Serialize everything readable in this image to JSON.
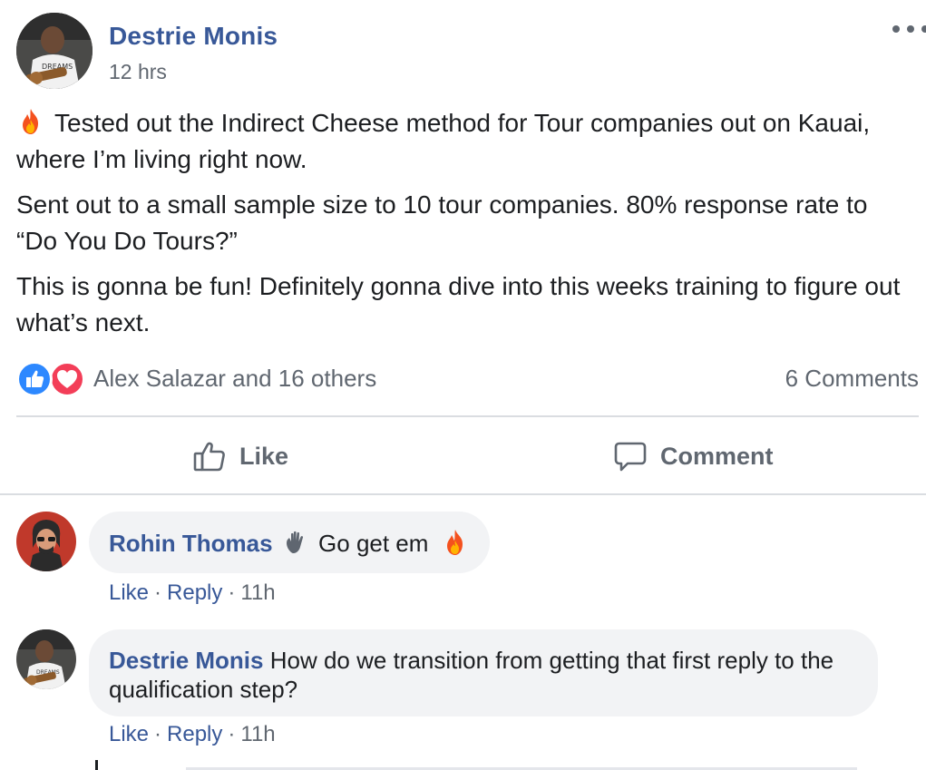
{
  "post": {
    "author": "Destrie Monis",
    "time": "12 hrs",
    "paragraph1": "Tested out the Indirect Cheese method for Tour companies out on Kauai, where I’m living right now.",
    "paragraph2": "Sent out to a small sample size to 10 tour companies. 80% response rate to “Do You Do Tours?”",
    "paragraph3": "This is gonna be fun! Definitely gonna dive into this weeks training to figure out what’s next.",
    "reactors": "Alex Salazar and 16 others",
    "comments_count": "6 Comments"
  },
  "actions": {
    "like": "Like",
    "comment": "Comment"
  },
  "comments": [
    {
      "author": "Rohin Thomas",
      "text": "Go get em",
      "like": "Like",
      "reply": "Reply",
      "time": "11h"
    },
    {
      "author": "Destrie Monis",
      "text": "How do we transition from getting that first reply to the qualification step?",
      "like": "Like",
      "reply": "Reply",
      "time": "11h"
    }
  ],
  "colors": {
    "link_blue": "#385898",
    "meta_gray": "#606770",
    "bubble_bg": "#f2f3f5",
    "like_blue": "#2d88ff",
    "love_red": "#f33e58"
  },
  "icons": [
    "fire-emoji-icon",
    "like-reaction-icon",
    "love-reaction-icon",
    "thumbs-up-icon",
    "comment-bubble-icon",
    "wave-hand-emoji-icon",
    "more-options-icon"
  ]
}
